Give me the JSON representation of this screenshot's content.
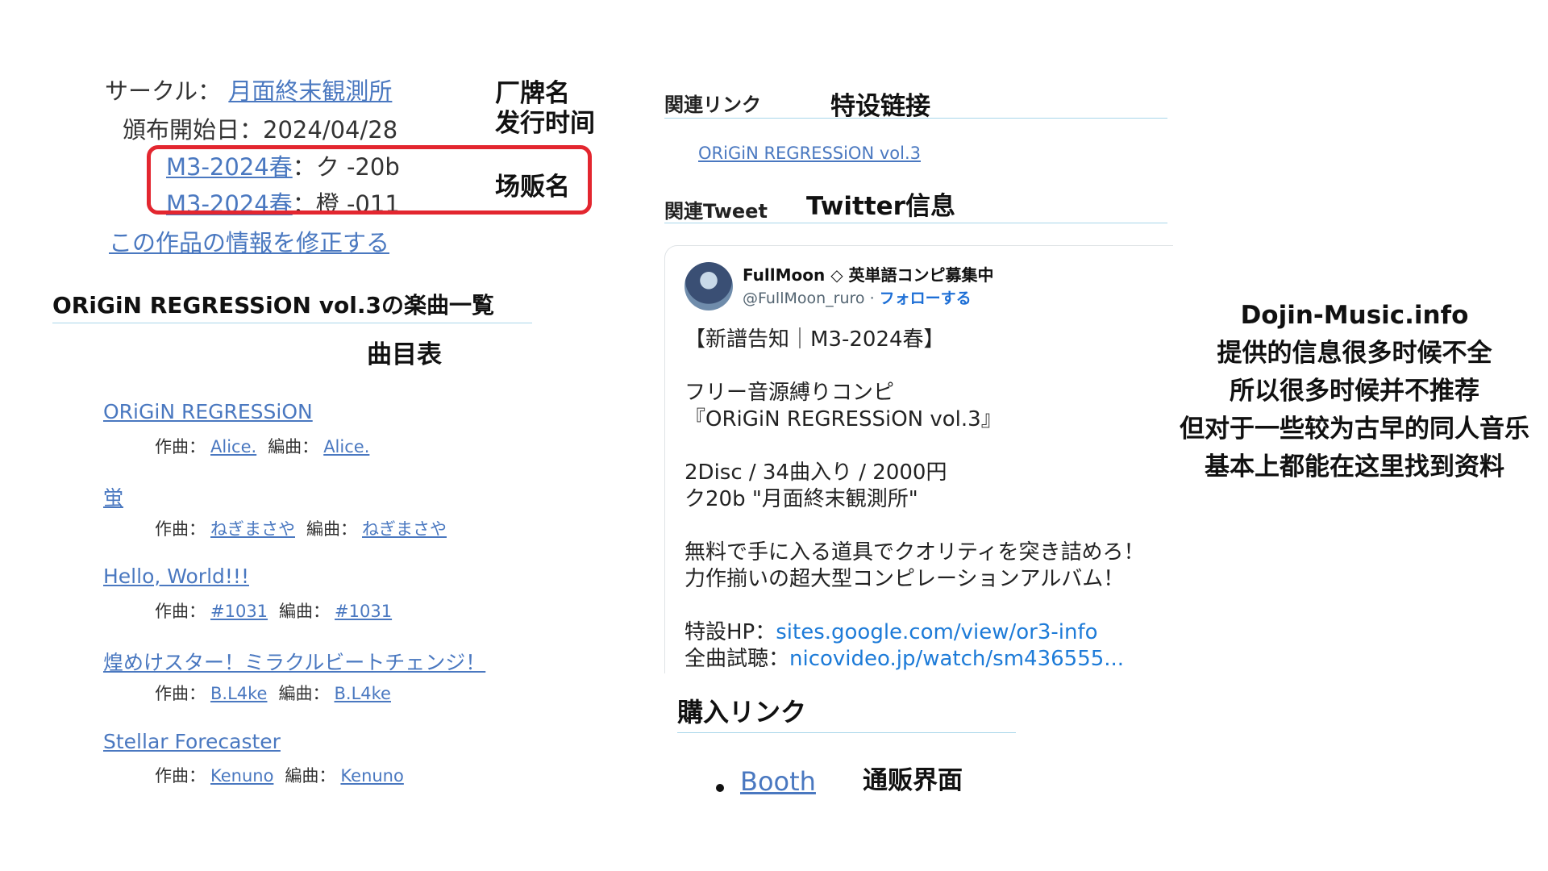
{
  "left": {
    "circle_label": "サークル：",
    "circle_link": "月面終末観測所",
    "release_label": "頒布開始日：",
    "release_date": "2024/04/28",
    "events": [
      {
        "link": "M3-2024春",
        "booth": "：ク -20b"
      },
      {
        "link": "M3-2024春",
        "booth": "：橙 -011"
      }
    ],
    "edit_link": "この作品の情報を修正する",
    "tracklist_title": "ORiGiN REGRESSiON vol.3の楽曲一覧",
    "composer_label": "作曲：",
    "arranger_label": "編曲：",
    "tracks": [
      {
        "title": "ORiGiN REGRESSiON",
        "composer": "Alice.",
        "arranger": "Alice."
      },
      {
        "title": "蛍",
        "composer": "ねぎまさや",
        "arranger": "ねぎまさや"
      },
      {
        "title": "Hello, World!!!",
        "composer": "#1031",
        "arranger": "#1031"
      },
      {
        "title": "煌めけスター！ミラクルビートチェンジ！",
        "composer": "B.L4ke",
        "arranger": "B.L4ke"
      },
      {
        "title": "Stellar Forecaster",
        "composer": "Kenuno",
        "arranger": "Kenuno"
      }
    ]
  },
  "annotations": {
    "brand": "厂牌名",
    "release_time": "发行时间",
    "event": "场贩名",
    "tracklist": "曲目表",
    "special_link": "特设链接",
    "twitter": "Twitter信息",
    "shop": "通贩界面"
  },
  "middle": {
    "related_links_label": "関連リンク",
    "related_link": "ORiGiN REGRESSiON vol.3",
    "related_tweet_label": "関連Tweet",
    "tweet": {
      "name": "FullMoon ◇ 英単語コンピ募集中",
      "handle": "@FullMoon_ruro",
      "separator": " · ",
      "follow": "フォローする",
      "lines": [
        "【新譜告知｜M3-2024春】",
        "",
        "フリー音源縛りコンピ",
        "『ORiGiN REGRESSiON vol.3』",
        "",
        "2Disc / 34曲入り / 2000円",
        "ク20b \"月面終末観測所\"",
        "",
        "無料で手に入る道具でクオリティを突き詰めろ！",
        "力作揃いの超大型コンピレーションアルバム！",
        ""
      ],
      "hp_label": "特設HP：",
      "hp_link": "sites.google.com/view/or3-info",
      "listen_label": "全曲試聴：",
      "listen_link": "nicovideo.jp/watch/sm436555..."
    },
    "purchase_title": "購入リンク",
    "purchase_link": "Booth"
  },
  "note": {
    "lines": [
      "Dojin-Music.info",
      "提供的信息很多时候不全",
      "所以很多时候并不推荐",
      "但对于一些较为古早的同人音乐",
      "基本上都能在这里找到资料"
    ]
  }
}
